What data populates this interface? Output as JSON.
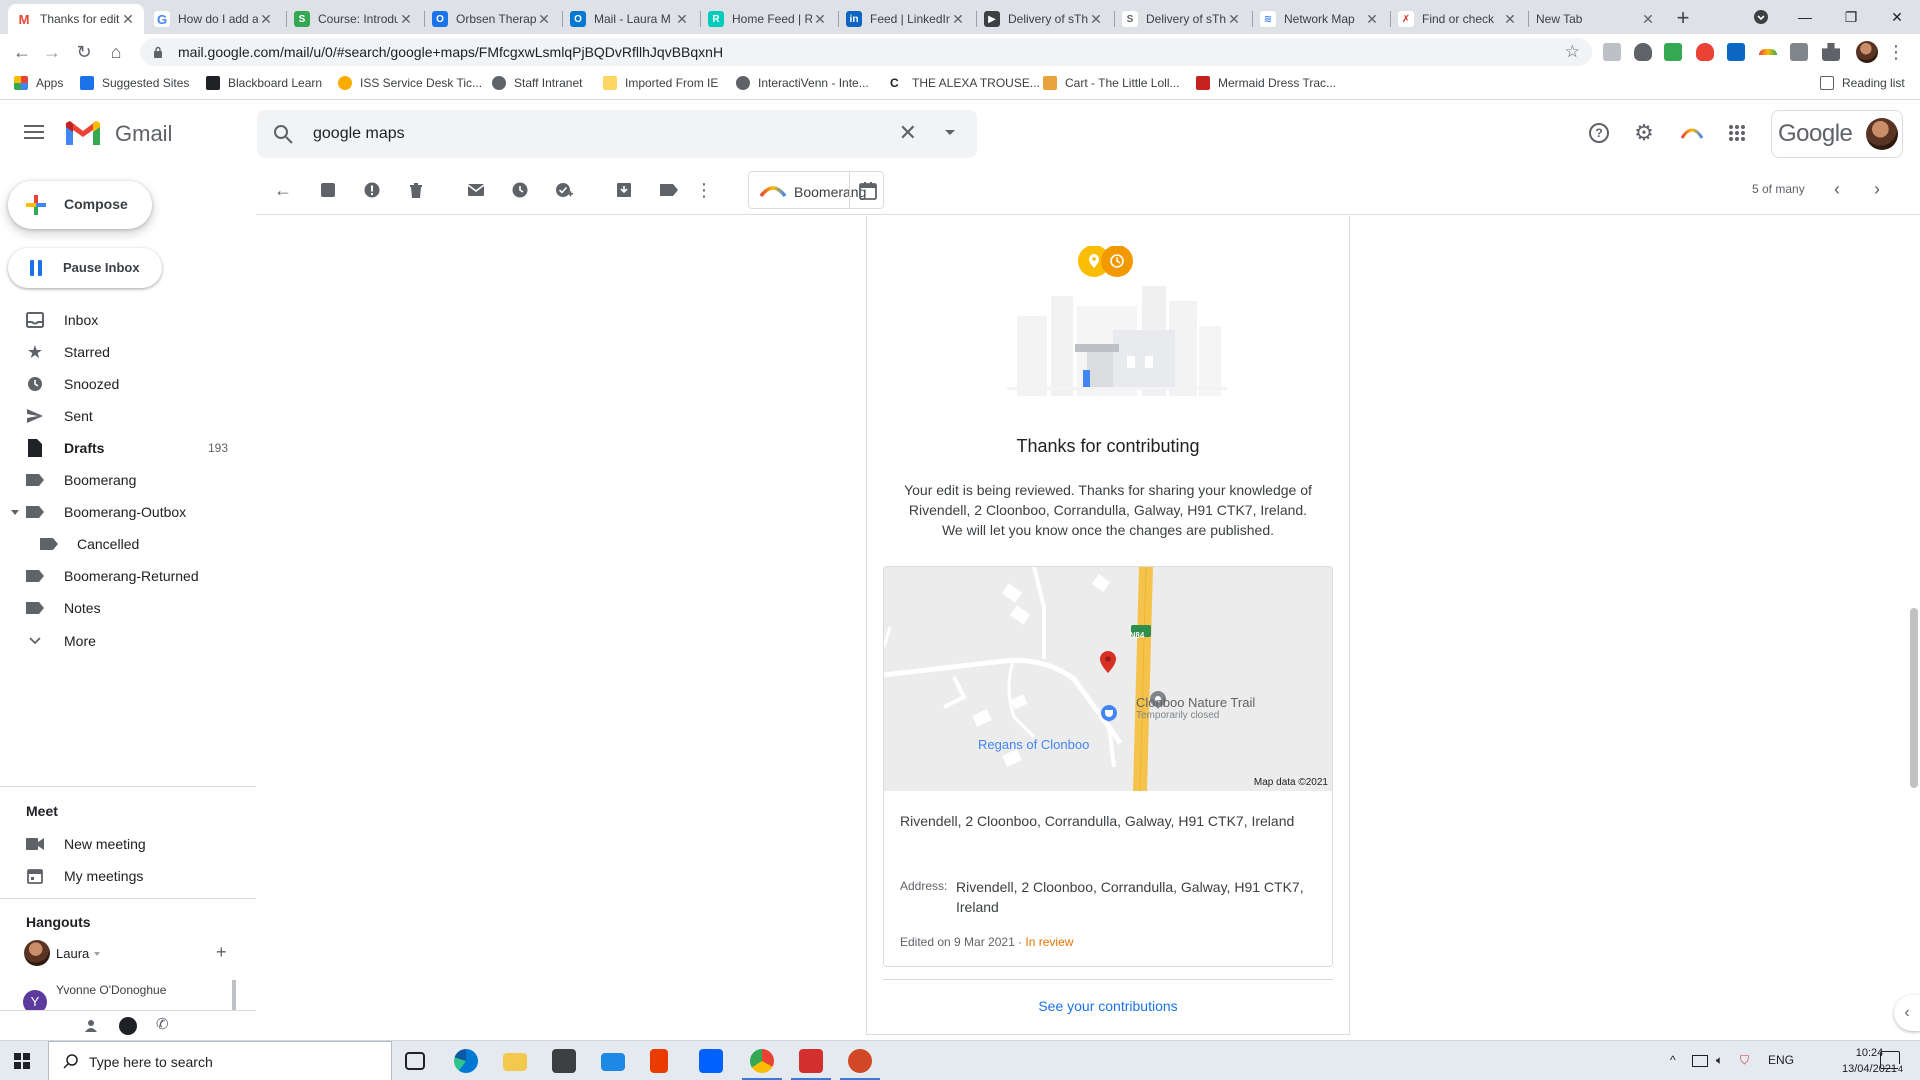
{
  "browser": {
    "tabs": [
      {
        "label": "Thanks for editing",
        "favicon": "gmail-icon",
        "color": "#ea4335",
        "active": true
      },
      {
        "label": "How do I add a place",
        "favicon": "google-icon",
        "color": "#4285f4"
      },
      {
        "label": "Course: Introduction",
        "favicon": "moodle-icon",
        "color": "#34a853"
      },
      {
        "label": "Orbsen Therapeutics",
        "favicon": "orbsen-icon",
        "color": "#1a73e8"
      },
      {
        "label": "Mail - Laura M",
        "favicon": "outlook-icon",
        "color": "#0078d4"
      },
      {
        "label": "Home Feed | R",
        "favicon": "researchgate-icon",
        "color": "#00ccbb"
      },
      {
        "label": "Feed | LinkedIn",
        "favicon": "linkedin-icon",
        "color": "#0a66c2"
      },
      {
        "label": "Delivery of sTh",
        "favicon": "delivery-icon",
        "color": "#3c4043"
      },
      {
        "label": "Delivery of sTh",
        "favicon": "delivery-icon",
        "color": "#5f6368"
      },
      {
        "label": "Network Map",
        "favicon": "network-icon",
        "color": "#4285f4"
      },
      {
        "label": "Find or check",
        "favicon": "check-icon",
        "color": "#d93025"
      },
      {
        "label": "New Tab",
        "favicon": "",
        "color": ""
      }
    ],
    "url": "mail.google.com/mail/u/0/#search/google+maps/FMfcgxwLsmlqPjBQDvRfllhJqvBBqxnH",
    "bookmarks": [
      {
        "label": "Apps",
        "icon": "apps-grid-icon",
        "color": "#4285f4"
      },
      {
        "label": "Suggested Sites",
        "icon": "suggested-sites-icon",
        "color": "#1a73e8"
      },
      {
        "label": "Blackboard Learn",
        "icon": "blackboard-icon",
        "color": "#202124"
      },
      {
        "label": "ISS Service Desk Tic...",
        "icon": "iss-icon",
        "color": "#f9ab00"
      },
      {
        "label": "Staff Intranet",
        "icon": "globe-icon",
        "color": "#5f6368"
      },
      {
        "label": "Imported From IE",
        "icon": "folder-icon",
        "color": "#fdd663"
      },
      {
        "label": "InteractiVenn - Inte...",
        "icon": "globe-icon",
        "color": "#5f6368"
      },
      {
        "label": "THE ALEXA TROUSE...",
        "icon": "c-icon",
        "color": "#202124"
      },
      {
        "label": "Cart - The Little Loll...",
        "icon": "cart-icon",
        "color": "#e8a33d"
      },
      {
        "label": "Mermaid Dress Trac...",
        "icon": "mermaid-icon",
        "color": "#c5221f"
      }
    ],
    "reading_list": "Reading list"
  },
  "gmail": {
    "brand": "Gmail",
    "search_value": "google maps",
    "google_word": "Google",
    "compose": "Compose",
    "pause_inbox": "Pause Inbox",
    "nav": [
      {
        "label": "Inbox",
        "icon": "inbox-icon"
      },
      {
        "label": "Starred",
        "icon": "star-icon"
      },
      {
        "label": "Snoozed",
        "icon": "clock-icon"
      },
      {
        "label": "Sent",
        "icon": "send-icon"
      },
      {
        "label": "Drafts",
        "icon": "draft-icon",
        "count": "193",
        "bold": true
      },
      {
        "label": "Boomerang",
        "icon": "label-icon"
      },
      {
        "label": "Boomerang-Outbox",
        "icon": "label-icon"
      },
      {
        "label": "Cancelled",
        "icon": "label-icon"
      },
      {
        "label": "Boomerang-Returned",
        "icon": "label-icon"
      },
      {
        "label": "Notes",
        "icon": "label-icon"
      },
      {
        "label": "More",
        "icon": "chevron-down-icon"
      }
    ],
    "meet": {
      "heading": "Meet",
      "new_meeting": "New meeting",
      "my_meetings": "My meetings"
    },
    "hangouts": {
      "heading": "Hangouts",
      "user": "Laura",
      "contact": "Yvonne O'Donoghue",
      "contact_initial": "Y"
    },
    "toolbar": {
      "boomerang": "Boomerang",
      "pager": "5 of many"
    }
  },
  "email": {
    "title": "Thanks for contributing",
    "body": "Your edit is being reviewed. Thanks for sharing your knowledge of Rivendell, 2 Cloonboo, Corrandulla, Galway, H91 CTK7, Ireland. We will let you know once the changes are published.",
    "map": {
      "road_label": "N84",
      "poi_1": "Clonboo Nature Trail",
      "poi_1_status": "Temporarily closed",
      "poi_2": "Regans of Clonboo",
      "credit": "Map data ©2021"
    },
    "place_line": "Rivendell, 2 Cloonboo, Corrandulla, Galway, H91 CTK7, Ireland",
    "address_key": "Address:",
    "address_value": "Rivendell, 2 Cloonboo, Corrandulla, Galway, H91 CTK7, Ireland",
    "edited_on": "Edited on 9 Mar 2021 ·",
    "status": "In review",
    "see_contributions": "See your contributions",
    "accent_orange": "#f9ab00",
    "link_blue": "#1a73e8"
  },
  "taskbar": {
    "search_placeholder": "Type here to search",
    "language": "ENG",
    "time": "10:24",
    "date": "13/04/2021",
    "notification_count": "4"
  }
}
